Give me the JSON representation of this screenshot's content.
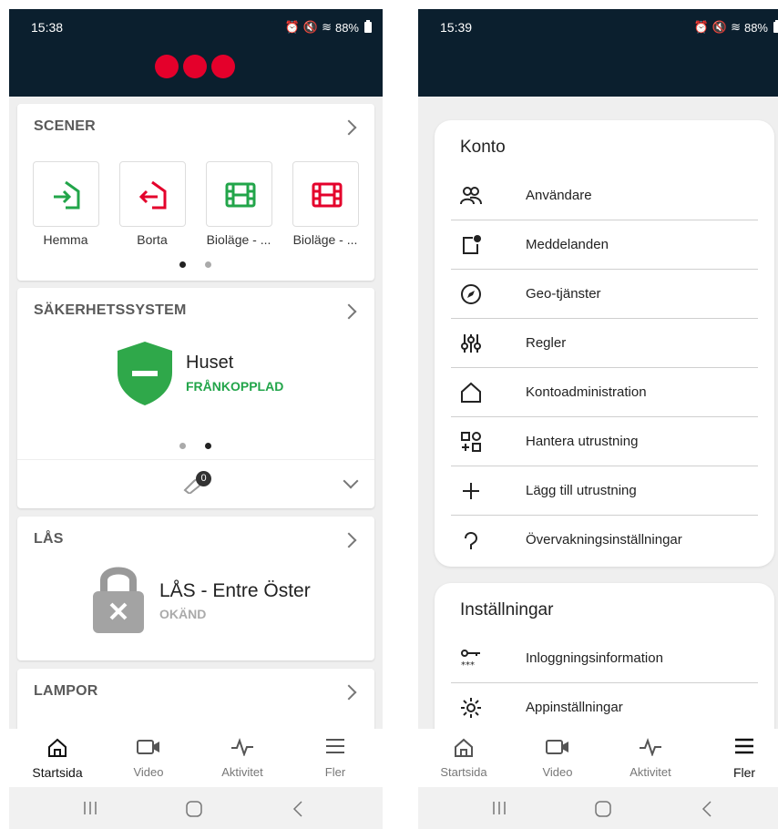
{
  "left": {
    "time": "15:38",
    "battery": "88%",
    "scenes": {
      "title": "SCENER",
      "tiles": [
        {
          "label": "Hemma",
          "icon": "home-enter-icon",
          "color": "#22a54a"
        },
        {
          "label": "Borta",
          "icon": "home-leave-icon",
          "color": "#e4002b"
        },
        {
          "label": "Bioläge - ...",
          "icon": "film-icon",
          "color": "#22a54a"
        },
        {
          "label": "Bioläge - ...",
          "icon": "film-icon",
          "color": "#e4002b"
        }
      ]
    },
    "security": {
      "title": "SÄKERHETSSYSTEM",
      "name": "Huset",
      "status": "FRÅNKOPPLAD",
      "status_color": "#22a54a",
      "badge": "0"
    },
    "lock": {
      "title": "LÅS",
      "name": "LÅS - Entre Öster",
      "status": "OKÄND"
    },
    "lamps": {
      "title": "LAMPOR"
    }
  },
  "right": {
    "time": "15:39",
    "battery": "88%",
    "konto": {
      "heading": "Konto",
      "items": [
        "Användare",
        "Meddelanden",
        "Geo-tjänster",
        "Regler",
        "Kontoadministration",
        "Hantera utrustning",
        "Lägg till utrustning",
        "Övervakningsinställningar"
      ]
    },
    "installningar": {
      "heading": "Inställningar",
      "items": [
        "Inloggningsinformation",
        "Appinställningar"
      ]
    }
  },
  "nav": {
    "items": [
      "Startsida",
      "Video",
      "Aktivitet",
      "Fler"
    ]
  }
}
